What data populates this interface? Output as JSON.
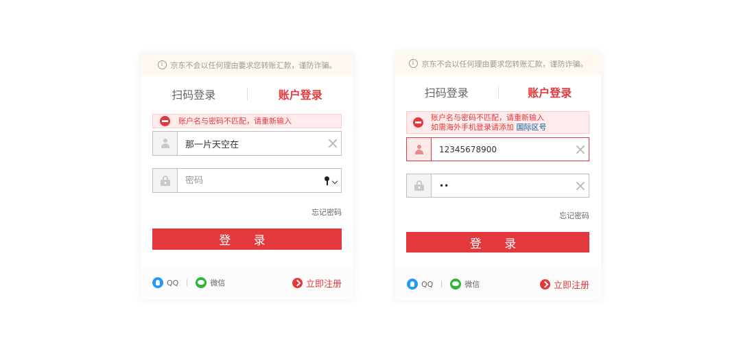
{
  "left_card": {
    "notice": "京东不会以任何理由要求您转账汇款，谨防诈骗。",
    "tab_qr": "扫码登录",
    "tab_account": "账户登录",
    "error_line1": "账户名与密码不匹配，请重新输入",
    "username_value": "那一片天空在",
    "password_placeholder": "密码",
    "forgot": "忘记密码",
    "login": "登 录",
    "qq": "QQ",
    "wechat": "微信",
    "register": "立即注册"
  },
  "right_card": {
    "notice": "京东不会以任何理由要求您转账汇款，谨防诈骗。",
    "tab_qr": "扫码登录",
    "tab_account": "账户登录",
    "error_line1": "账户名与密码不匹配，请重新输入",
    "error_line2": "如需海外手机登录请添加",
    "error_link": "国际区号",
    "username_value": "12345678900",
    "password_value": "••",
    "forgot": "忘记密码",
    "login": "登 录",
    "qq": "QQ",
    "wechat": "微信",
    "register": "立即注册"
  },
  "colors": {
    "accent": "#e4393c",
    "link": "#005aa0",
    "notice_bg": "#fff8f0"
  },
  "icons": [
    "info-icon",
    "error-icon",
    "user-icon",
    "lock-icon",
    "clear-icon",
    "key-icon",
    "qq-icon",
    "wechat-icon",
    "arrow-right-icon"
  ]
}
